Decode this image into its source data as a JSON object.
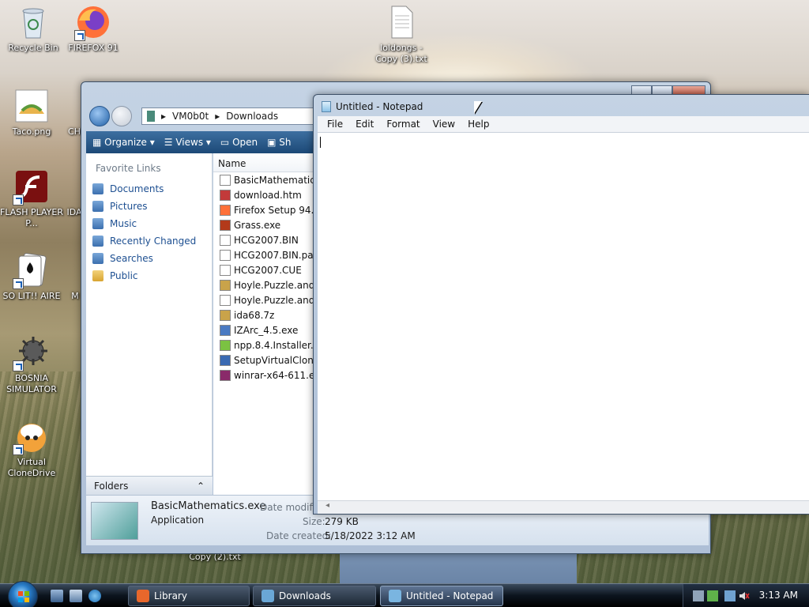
{
  "desktop": {
    "icons": [
      {
        "label": "Recycle Bin"
      },
      {
        "label": "FIREFOX 91"
      },
      {
        "label": "loldongs - Copy (3).txt"
      },
      {
        "label": "Taco.png"
      },
      {
        "label": "CH"
      },
      {
        "label": "FLASH PLAYER P..."
      },
      {
        "label": "IDA"
      },
      {
        "label": "SO LIT!! AIRE"
      },
      {
        "label": "M"
      },
      {
        "label": "BOSNIA SIMULATOR"
      },
      {
        "label": "Virtual CloneDrive"
      },
      {
        "label": "Copy (2).txt"
      }
    ]
  },
  "explorer": {
    "breadcrumb": [
      "VM0b0t",
      "Downloads"
    ],
    "toolbar": {
      "organize": "Organize",
      "views": "Views",
      "open": "Open",
      "share": "Sh"
    },
    "nav_header": "Favorite Links",
    "favorites": [
      "Documents",
      "Pictures",
      "Music",
      "Recently Changed",
      "Searches",
      "Public"
    ],
    "folders_label": "Folders",
    "column_name": "Name",
    "files": [
      "BasicMathematics.",
      "download.htm",
      "Firefox Setup 94.0.1",
      "Grass.exe",
      "HCG2007.BIN",
      "HCG2007.BIN.part",
      "HCG2007.CUE",
      "Hoyle.Puzzle.and.B",
      "Hoyle.Puzzle.and.B",
      "ida68.7z",
      "IZArc_4.5.exe",
      "npp.8.4.Installer.x64",
      "SetupVirtualCloneD",
      "winrar-x64-611.exe"
    ],
    "details": {
      "name": "BasicMathematics.exe",
      "type": "Application",
      "modified_label": "Date modified",
      "size_label": "Size:",
      "size_value": "279 KB",
      "created_label": "Date created:",
      "created_value": "5/18/2022 3:12 AM"
    }
  },
  "notepad": {
    "title": "Untitled - Notepad",
    "menu": [
      "File",
      "Edit",
      "Format",
      "View",
      "Help"
    ],
    "content": ""
  },
  "taskbar": {
    "tasks": [
      {
        "label": "Library",
        "color": "#e8672b"
      },
      {
        "label": "Downloads",
        "color": "#6aa7d6"
      },
      {
        "label": "Untitled - Notepad",
        "color": "#7ab5e0"
      }
    ],
    "clock": "3:13 AM"
  },
  "colors": {
    "accent": "#1d4f91",
    "toolbar": "#1c4977"
  }
}
